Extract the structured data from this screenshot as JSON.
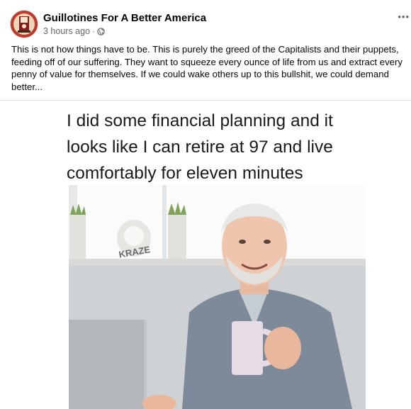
{
  "post": {
    "page_name": "Guillotines For A Better America",
    "timestamp": "3 hours ago",
    "separator": "·",
    "privacy_icon": "globe-icon",
    "more_icon": "more-options-icon",
    "text": "This is not how things have to be. This is purely the greed of the Capitalists and their puppets, feeding off of our suffering. They want to squeeze every ounce of life from us and extract every penny of value for themselves. If we could wake others up to this bullshit, we could demand better..."
  },
  "meme": {
    "caption": "I did some financial planning and it looks like I can retire at 97 and live comfortably for eleven minutes",
    "watermark": "KRAZE",
    "image_description_icon": "man-with-coffee-mug-photo"
  },
  "colors": {
    "text_primary": "#050505",
    "text_secondary": "#65676b",
    "avatar_bg": "#c0392b"
  }
}
